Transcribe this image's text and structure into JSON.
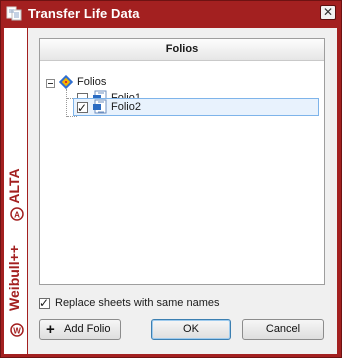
{
  "window": {
    "title": "Transfer Life Data",
    "close_glyph": "✕"
  },
  "brand": {
    "product1": "ALTA",
    "product2": "Weibull++",
    "accent": "#a32020"
  },
  "tree": {
    "header": "Folios",
    "root_label": "Folios",
    "items": [
      {
        "label": "Folio1",
        "checked": false
      },
      {
        "label": "Folio2",
        "checked": true
      }
    ]
  },
  "options": {
    "replace_label": "Replace sheets with same names",
    "replace_checked": true
  },
  "buttons": {
    "add_folio_icon": "+",
    "add_folio": "Add Folio",
    "ok": "OK",
    "cancel": "Cancel"
  }
}
